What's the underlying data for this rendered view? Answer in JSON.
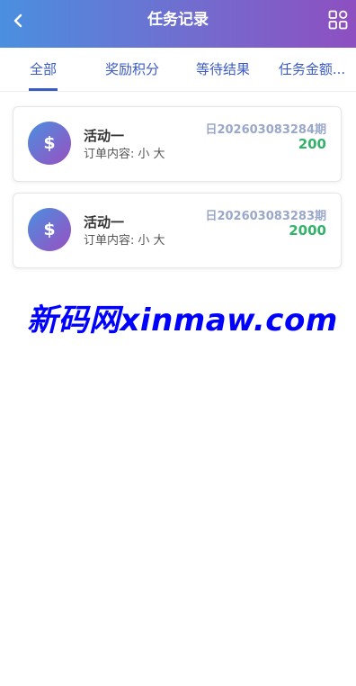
{
  "header": {
    "title": "任务记录",
    "back_icon": "chevron-left-icon",
    "menu_icon": "grid-icon"
  },
  "colors": {
    "brand_start": "#4a8fe0",
    "brand_end": "#8e4fc0",
    "tab_active": "#3c5bc3",
    "amount": "#33b36a",
    "period": "#9aa7c8"
  },
  "tabs": [
    {
      "label": "全部",
      "active": true
    },
    {
      "label": "奖励积分"
    },
    {
      "label": "等待结果"
    },
    {
      "label": "任务金额..."
    }
  ],
  "records": [
    {
      "icon_symbol": "$",
      "title": "活动一",
      "desc_label": "订单内容:",
      "desc_value": "小 大",
      "period": "日202603083284期",
      "amount": "200"
    },
    {
      "icon_symbol": "$",
      "title": "活动一",
      "desc_label": "订单内容:",
      "desc_value": "小 大",
      "period": "日202603083283期",
      "amount": "2000"
    }
  ],
  "watermark": "新码网xinmaw.com"
}
